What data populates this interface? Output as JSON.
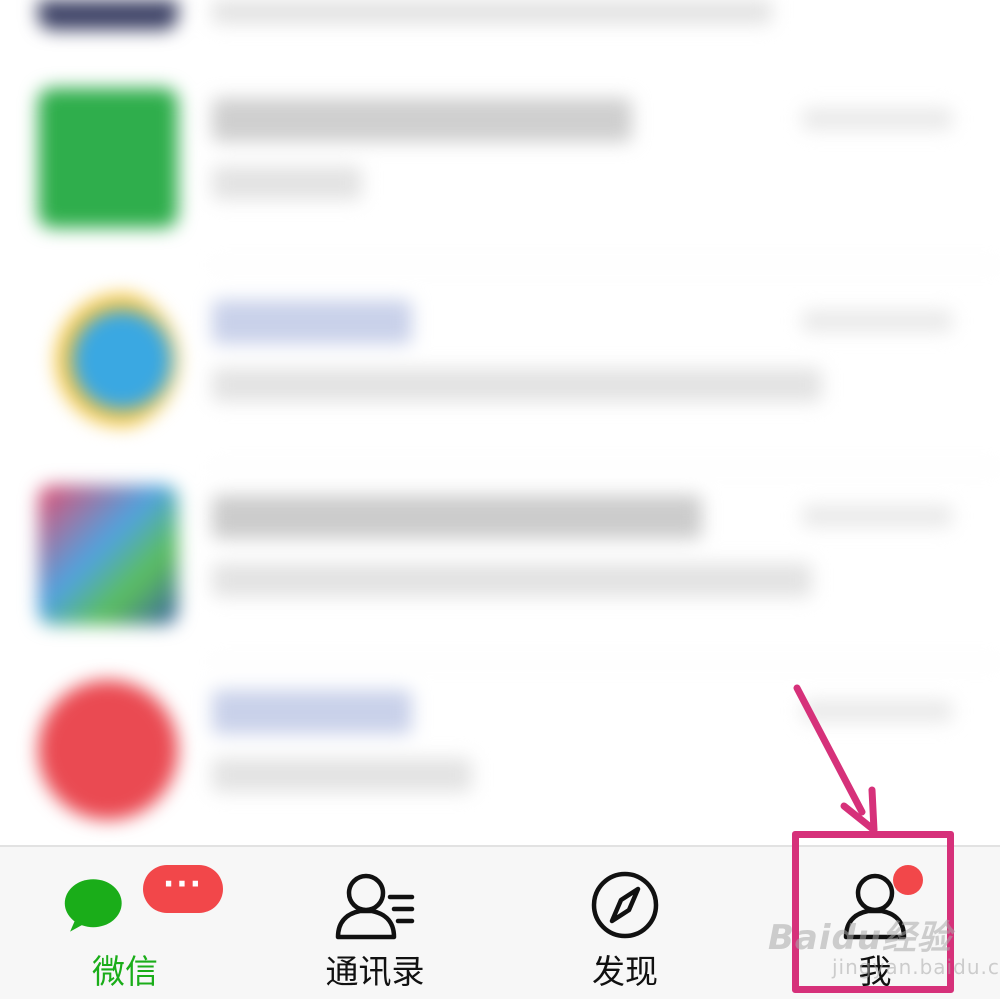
{
  "tab_bar": {
    "tabs": [
      {
        "id": "chats",
        "label": "微信",
        "icon": "chat-bubbles-icon",
        "active": true,
        "badge": "···"
      },
      {
        "id": "contacts",
        "label": "通讯录",
        "icon": "contacts-icon",
        "active": false
      },
      {
        "id": "discover",
        "label": "发现",
        "icon": "compass-icon",
        "active": false
      },
      {
        "id": "me",
        "label": "我",
        "icon": "person-icon",
        "active": false,
        "dot": true
      }
    ]
  },
  "colors": {
    "active_green": "#1aad19",
    "badge_red": "#f2474a",
    "annotation_pink": "#d6317a"
  },
  "watermark": {
    "main": "Baidu经验",
    "sub": "jingyan.baidu.com"
  }
}
